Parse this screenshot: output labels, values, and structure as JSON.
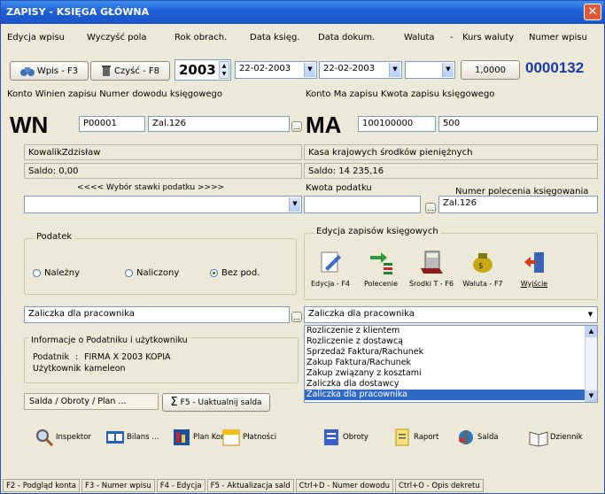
{
  "window": {
    "title": "ZAPISY - KSIĘGA GŁÓWNA",
    "close_glyph": "✕"
  },
  "top_labels": [
    "Edycja wpisu",
    "Wyczyść pola",
    "Rok obrach.",
    "Data księg.",
    "Data dokum.",
    "Waluta",
    "-",
    "Kurs waluty",
    "Numer wpisu"
  ],
  "toolbar": {
    "wpis_label": "Wpis - F3",
    "czysc_label": "Czyść - F8",
    "year": "2003",
    "data_ksieg": "22-02-2003",
    "data_dokum": "22-02-2003",
    "waluta": "",
    "kurs": "1,0000",
    "numer_wpisu": "0000132"
  },
  "labels_row2": {
    "left": "Konto  Winien  zapisu        Numer dowodu księgowego",
    "right": "Konto   Ma   zapisu           Kwota zapisu księgowego"
  },
  "wn": {
    "big": "WN",
    "konto": "P00001",
    "dowod": "Zal.126",
    "btn": "..."
  },
  "ma": {
    "big": "MA",
    "konto": "100100000",
    "kwota": "500"
  },
  "wn_name": "KowalikZdzisław",
  "wn_saldo": "Saldo: 0,00",
  "ma_name": "Kasa krajowych środków pieniężnych",
  "ma_saldo": "Saldo: 14 235,16",
  "tax": {
    "stawka_label": "<<<<  Wybór stawki podatku  >>>>",
    "stawka_value": "",
    "kwota_label": "Kwota podatku",
    "kwota_value": "",
    "polecenie_label": "Numer polecenia księgowania",
    "polecenie_value": "Zal.126"
  },
  "podatek": {
    "title": "Podatek",
    "options": [
      "Należny",
      "Naliczony",
      "Bez pod."
    ],
    "selected": "Bez pod."
  },
  "edycja": {
    "title": "Edycja zapisów księgowych",
    "tools": [
      "Edycja - F4",
      "Polecenie",
      "Środki T - F6",
      "Waluta - F7",
      "Wyjście"
    ]
  },
  "desc_left": "Zaliczka dla pracownika",
  "desc_right": "Zaliczka dla pracownika",
  "dropdown_options": [
    "Rozliczenie z klientem",
    "Rozliczenie z dostawcą",
    "Sprzedaż Faktura/Rachunek",
    "Zakup Faktura/Rachunek",
    "Zakup związany z kosztami",
    "Zaliczka dla dostawcy",
    "Zaliczka dla pracownika"
  ],
  "dropdown_selected_index": 6,
  "info": {
    "title": "Informacje o Podatniku i użytkowniku",
    "podatnik_label": "Podatnik",
    "podatnik_value": "FIRMA X 2003  KOPIA",
    "uzytkownik_label": "Użytkownik",
    "uzytkownik_value": "kameleon"
  },
  "saldo_tab": "Salda / Obroty / Plan ...",
  "uaktualnij_label": "F5 -  Uaktualnij salda",
  "sigma": "Σ",
  "bottom_tools": [
    "Inspektor",
    "Bilans ...",
    "Plan Kont",
    "Płatności",
    "Obroty",
    "Raport",
    "Salda",
    "Dziennik"
  ],
  "statusbar": [
    "F2 - Podgląd konta",
    "F3 - Numer wpisu",
    "F4 - Edycja",
    "F5 - Aktualizacja sald",
    "Ctrl+D - Numer dowodu",
    "Ctrl+O - Opis dekretu"
  ]
}
